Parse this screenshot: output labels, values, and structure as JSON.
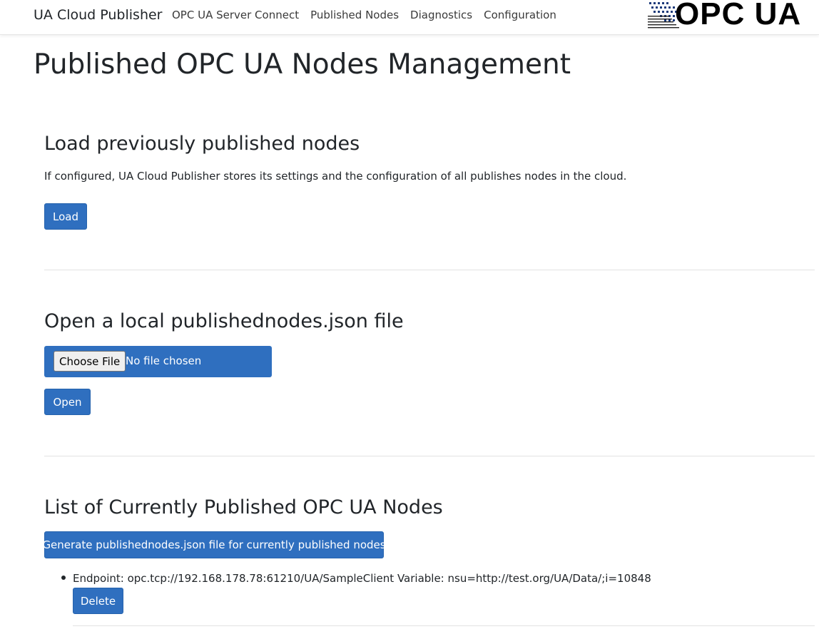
{
  "navbar": {
    "brand": "UA Cloud Publisher",
    "links": [
      {
        "label": "OPC UA Server Connect"
      },
      {
        "label": "Published Nodes"
      },
      {
        "label": "Diagnostics"
      },
      {
        "label": "Configuration"
      }
    ],
    "logo_text": "OPC UA"
  },
  "page": {
    "title": "Published OPC UA Nodes Management"
  },
  "load_section": {
    "title": "Load previously published nodes",
    "description": "If configured, UA Cloud Publisher stores its settings and the configuration of all publishes nodes in the cloud.",
    "button_label": "Load"
  },
  "open_section": {
    "title": "Open a local publishednodes.json file",
    "choose_file_label": "Choose File",
    "file_status": "No file chosen",
    "button_label": "Open"
  },
  "list_section": {
    "title": "List of Currently Published OPC UA Nodes",
    "generate_label": "Generate publishednodes.json file for currently published nodes",
    "nodes": [
      {
        "text": "Endpoint: opc.tcp://192.168.178.78:61210/UA/SampleClient Variable: nsu=http://test.org/UA/Data/;i=10848",
        "delete_label": "Delete"
      }
    ]
  },
  "colors": {
    "primary": "#2f6fbf",
    "text": "#212529"
  }
}
